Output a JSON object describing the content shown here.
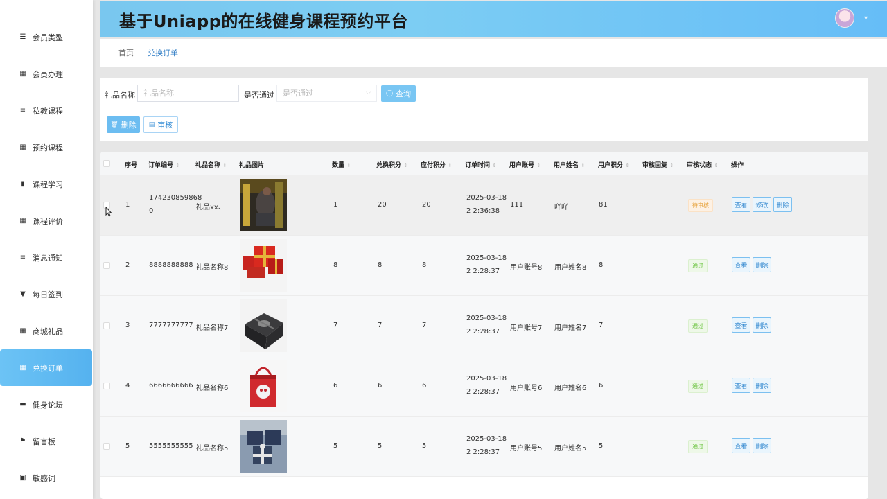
{
  "app": {
    "title": "基于Uniapp的在线健身课程预约平台"
  },
  "sidebar": {
    "items": [
      {
        "label": "会员类型",
        "icon": "sliders-icon"
      },
      {
        "label": "会员办理",
        "icon": "grid-icon"
      },
      {
        "label": "私教课程",
        "icon": "list-icon"
      },
      {
        "label": "预约课程",
        "icon": "grid-icon"
      },
      {
        "label": "课程学习",
        "icon": "chart-icon"
      },
      {
        "label": "课程评价",
        "icon": "grid-icon"
      },
      {
        "label": "消息通知",
        "icon": "list-icon"
      },
      {
        "label": "每日签到",
        "icon": "bookmark-icon"
      },
      {
        "label": "商城礼品",
        "icon": "grid-icon"
      },
      {
        "label": "兑换订单",
        "icon": "grid-icon",
        "active": true
      },
      {
        "label": "健身论坛",
        "icon": "ticket-icon"
      },
      {
        "label": "留言板",
        "icon": "flag-icon"
      },
      {
        "label": "敏感词",
        "icon": "clipboard-icon"
      }
    ]
  },
  "breadcrumb": {
    "home": "首页",
    "current": "兑换订单"
  },
  "search": {
    "gift_label": "礼品名称",
    "gift_placeholder": "礼品名称",
    "passed_label": "是否通过",
    "passed_placeholder": "是否通过",
    "query_label": "查询",
    "delete_label": "删除",
    "review_label": "审核"
  },
  "table": {
    "headers": {
      "index": "序号",
      "order_no": "订单编号",
      "gift_name": "礼品名称",
      "gift_image": "礼品图片",
      "quantity": "数量",
      "exchange_points": "兑换积分",
      "payable_points": "应付积分",
      "order_time": "订单时间",
      "user_account": "用户账号",
      "user_name": "用户姓名",
      "user_points": "用户积分",
      "review_reply": "审核回复",
      "review_status": "审核状态",
      "actions": "操作"
    },
    "rows": [
      {
        "index": "1",
        "order_no": "174230859868 0",
        "gift_name": "礼品xx、",
        "quantity": "1",
        "exchange_points": "20",
        "payable_points": "20",
        "order_time": "2025-03-18 2 2:36:38",
        "user_account": "111",
        "user_name": "吖吖",
        "user_points": "81",
        "status": "待审核",
        "status_type": "pending",
        "actions": [
          "查看",
          "修改",
          "删除"
        ]
      },
      {
        "index": "2",
        "order_no": "8888888888",
        "gift_name": "礼品名称8",
        "quantity": "8",
        "exchange_points": "8",
        "payable_points": "8",
        "order_time": "2025-03-18 2 2:28:37",
        "user_account": "用户账号8",
        "user_name": "用户姓名8",
        "user_points": "8",
        "status": "通过",
        "status_type": "pass",
        "actions": [
          "查看",
          "删除"
        ]
      },
      {
        "index": "3",
        "order_no": "7777777777",
        "gift_name": "礼品名称7",
        "quantity": "7",
        "exchange_points": "7",
        "payable_points": "7",
        "order_time": "2025-03-18 2 2:28:37",
        "user_account": "用户账号7",
        "user_name": "用户姓名7",
        "user_points": "7",
        "status": "通过",
        "status_type": "pass",
        "actions": [
          "查看",
          "删除"
        ]
      },
      {
        "index": "4",
        "order_no": "6666666666",
        "gift_name": "礼品名称6",
        "quantity": "6",
        "exchange_points": "6",
        "payable_points": "6",
        "order_time": "2025-03-18 2 2:28:37",
        "user_account": "用户账号6",
        "user_name": "用户姓名6",
        "user_points": "6",
        "status": "通过",
        "status_type": "pass",
        "actions": [
          "查看",
          "删除"
        ]
      },
      {
        "index": "5",
        "order_no": "5555555555",
        "gift_name": "礼品名称5",
        "quantity": "5",
        "exchange_points": "5",
        "payable_points": "5",
        "order_time": "2025-03-18 2 2:28:37",
        "user_account": "用户账号5",
        "user_name": "用户姓名5",
        "user_points": "5",
        "status": "通过",
        "status_type": "pass",
        "actions": [
          "查看",
          "删除"
        ]
      }
    ]
  },
  "colors": {
    "accent": "#6cbdf1",
    "header": "#79c7ef",
    "pending": "#e6a23c",
    "pass": "#67c23a"
  }
}
